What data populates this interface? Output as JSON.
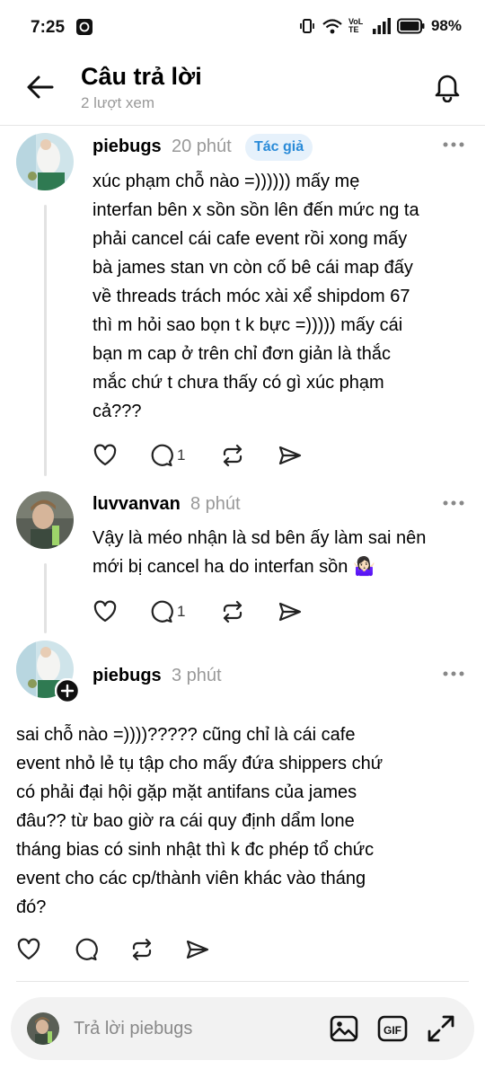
{
  "status": {
    "time": "7:25",
    "battery": "98%",
    "network": "VoLTE"
  },
  "header": {
    "title": "Câu trả lời",
    "subtitle": "2 lượt xem"
  },
  "posts": [
    {
      "username": "piebugs",
      "time": "20 phút",
      "badge": "Tác giả",
      "text": "xúc phạm chỗ nào =)))))) mấy mẹ\ninterfan bên x sồn sồn lên đến mức ng ta\nphải cancel cái cafe event rồi xong mấy\nbà james stan vn còn cố bê cái map đấy\nvề threads trách móc xài xể shipdom 67\nthì m hỏi sao bọn t k bực =))))) mấy cái\nbạn m cap ở trên chỉ đơn giản là thắc\nmắc chứ t chưa thấy có gì xúc phạm\ncả???",
      "reply_count": "1"
    },
    {
      "username": "luvvanvan",
      "time": "8 phút",
      "text": "Vậy là méo nhận là sd bên ấy làm sai nên\nmới bị cancel ha do interfan sồn 🤷🏻‍♀️",
      "reply_count": "1"
    },
    {
      "username": "piebugs",
      "time": "3 phút",
      "text": "sai chỗ nào =))))????? cũng chỉ là cái cafe\nevent nhỏ lẻ tụ tập cho mấy đứa shippers chứ\ncó phải đại hội gặp mặt antifans của james\nđâu?? từ bao giờ ra cái quy định dẩm lone\ntháng bias có sinh nhật thì k đc phép tổ chức\nevent cho các cp/thành viên khác vào tháng\nđó?"
    }
  ],
  "reply_bar": {
    "placeholder": "Trả lời piebugs"
  },
  "icons": {
    "back": "arrow-left-icon",
    "bell": "bell-icon",
    "like": "heart-icon",
    "comment": "comment-icon",
    "repost": "repost-icon",
    "share": "send-icon",
    "more": "more-horizontal-icon",
    "image": "image-icon",
    "gif": "gif-icon",
    "expand": "expand-icon"
  },
  "colors": {
    "badge_bg": "#e6f1fb",
    "badge_text": "#2a8bd8",
    "muted": "#999999"
  }
}
